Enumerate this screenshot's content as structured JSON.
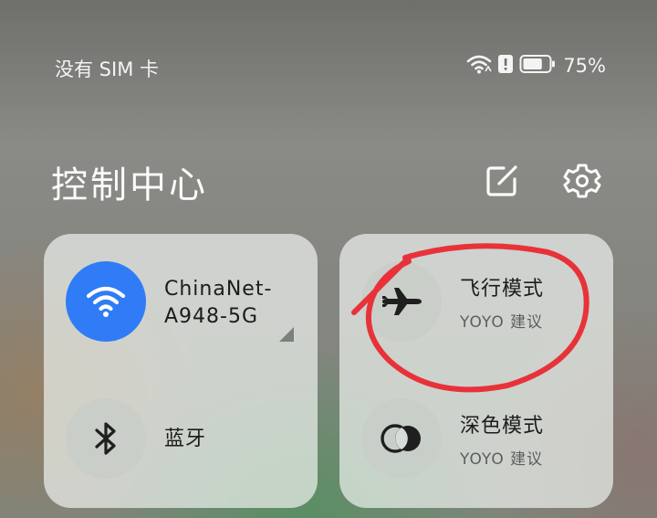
{
  "status_bar": {
    "carrier": "没有 SIM 卡",
    "battery_percent": "75%",
    "battery_level": 0.75,
    "icons": [
      "wifi-icon",
      "alert-icon",
      "battery-icon"
    ]
  },
  "header": {
    "title": "控制中心",
    "icons": [
      "edit-icon",
      "gear-icon"
    ]
  },
  "tiles": {
    "wifi": {
      "label_line1": "ChinaNet-",
      "label_line2": "A948-5G",
      "active": true,
      "icon": "wifi-icon"
    },
    "bluetooth": {
      "label": "蓝牙",
      "active": false,
      "icon": "bluetooth-icon"
    },
    "airplane": {
      "label": "飞行模式",
      "sub": "YOYO 建议",
      "active": false,
      "icon": "airplane-icon"
    },
    "dark_mode": {
      "label": "深色模式",
      "sub": "YOYO 建议",
      "active": false,
      "icon": "dark-mode-icon"
    }
  },
  "colors": {
    "accent": "#2f7cf6",
    "annotation": "#e8323a"
  }
}
